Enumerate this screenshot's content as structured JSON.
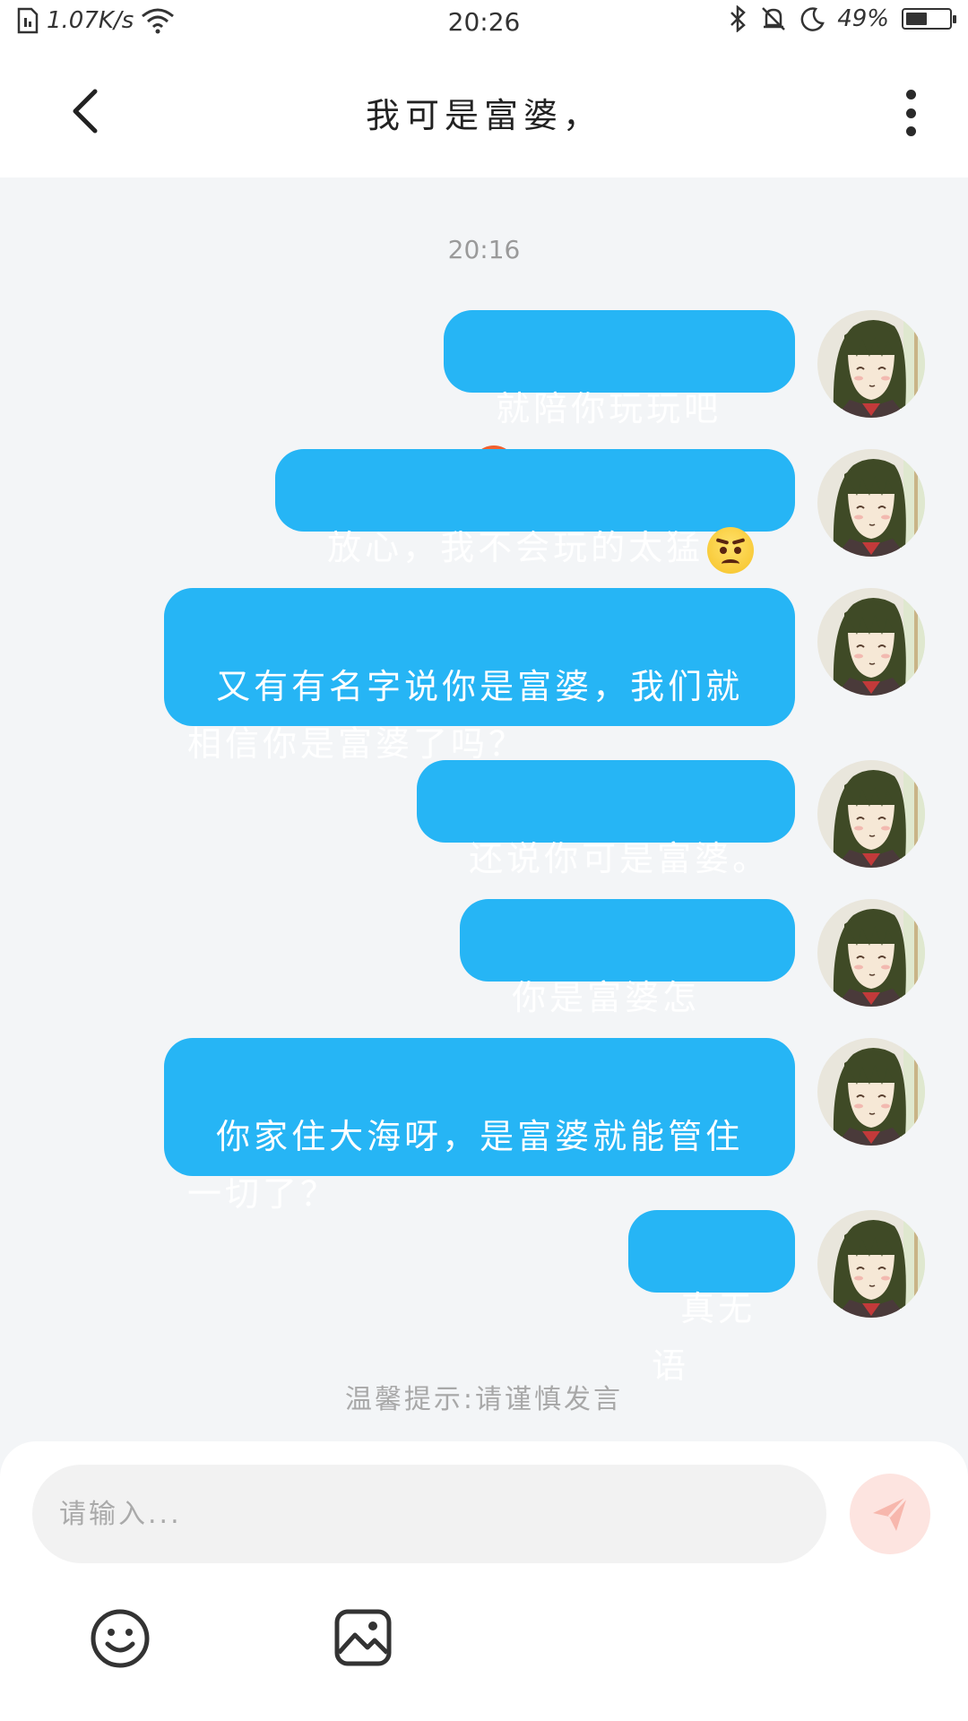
{
  "status_bar": {
    "net_speed": "1.07K/s",
    "time": "20:26",
    "battery": "49%",
    "battery_level": 0.49
  },
  "header": {
    "title": "我可是富婆，",
    "back_icon": "chevron-left-icon",
    "more_icon": "more-vertical-icon"
  },
  "chat": {
    "timestamp": "20:16",
    "messages": [
      {
        "text": "就陪你玩玩吧",
        "emoji": "angry-face-emoji"
      },
      {
        "text": "放心，我不会玩的太猛",
        "emoji": "annoyed-face-emoji"
      },
      {
        "text": "又有有名字说你是富婆，我们就相信你是富婆了吗？"
      },
      {
        "text": "还说你可是富婆。"
      },
      {
        "text": "你是富婆怎么？"
      },
      {
        "text": "你家住大海呀，是富婆就能管住一切了？"
      },
      {
        "text": "真无语"
      }
    ],
    "tip": "温馨提示:请谨慎发言"
  },
  "input": {
    "placeholder": "请输入...",
    "send_icon": "send-icon",
    "emoji_icon": "smiley-icon",
    "image_icon": "image-icon"
  },
  "colors": {
    "bubble": "#26b5f5",
    "background": "#f3f5f7",
    "send_button": "#fde4e0"
  }
}
